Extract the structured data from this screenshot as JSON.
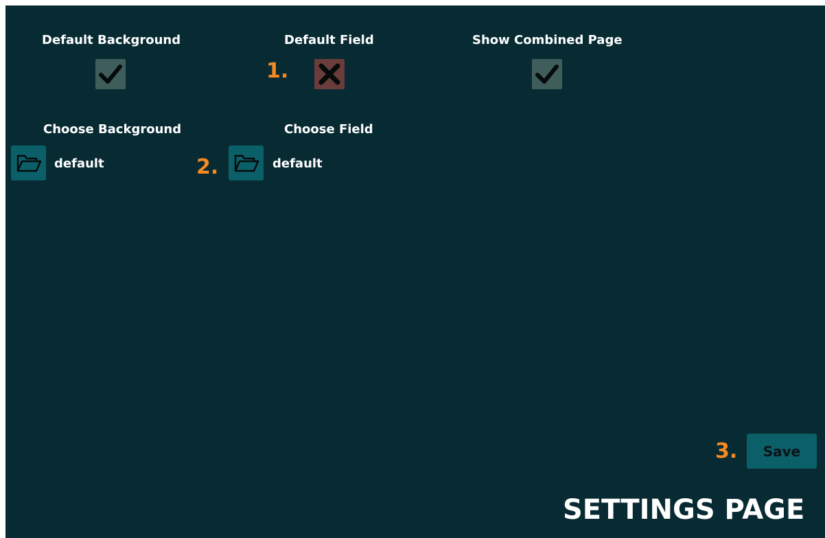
{
  "settings": {
    "default_background": {
      "label": "Default Background",
      "checked": true
    },
    "default_field": {
      "label": "Default Field",
      "checked": false,
      "step": "1."
    },
    "show_combined_page": {
      "label": "Show Combined Page",
      "checked": true
    },
    "choose_background": {
      "label": "Choose Background",
      "value": "default",
      "icon": "folder-open-icon"
    },
    "choose_field": {
      "label": "Choose Field",
      "value": "default",
      "step": "2.",
      "icon": "folder-open-icon"
    }
  },
  "save": {
    "label": "Save",
    "step": "3."
  },
  "page_title": "SETTINGS PAGE",
  "colors": {
    "background": "#082b33",
    "checkbox_on": "#3f5e5b",
    "checkbox_off": "#6a3c3b",
    "button": "#0b5f68",
    "step_number": "#f58a22",
    "text": "#ffffff"
  }
}
